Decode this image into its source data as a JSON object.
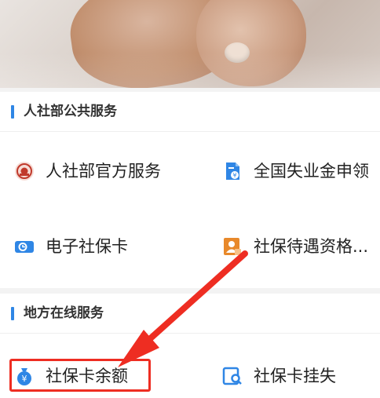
{
  "sections": [
    {
      "title": "人社部公共服务",
      "items": [
        {
          "label": "人社部官方服务",
          "icon": "ministry-emblem-icon"
        },
        {
          "label": "全国失业金申领",
          "icon": "unemployment-document-icon"
        },
        {
          "label": "电子社保卡",
          "icon": "social-security-card-icon"
        },
        {
          "label": "社保待遇资格...",
          "icon": "qualification-person-icon"
        }
      ]
    },
    {
      "title": "地方在线服务",
      "items": [
        {
          "label": "社保卡余额",
          "icon": "money-bag-icon"
        },
        {
          "label": "社保卡挂失",
          "icon": "search-window-icon"
        }
      ]
    }
  ],
  "colors": {
    "accent": "#2f86e5",
    "annotation": "#ee2d22",
    "emblem": "#c0392b",
    "orange": "#e8892b"
  }
}
